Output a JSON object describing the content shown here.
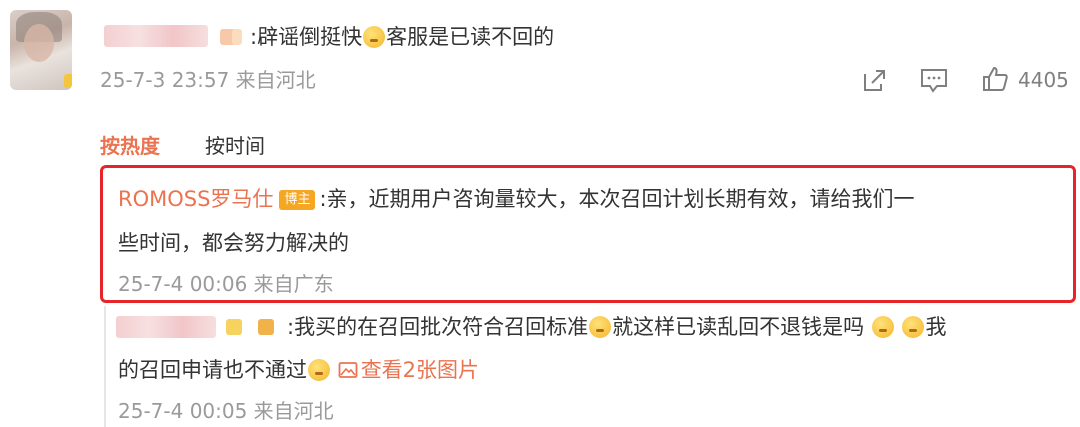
{
  "comment1": {
    "text_part1": ":辟谣倒挺快",
    "text_part2": "客服是已读不回的",
    "meta": "25-7-3 23:57 来自河北",
    "like_count": "4405",
    "icons": [
      "share-icon",
      "comment-icon",
      "like-icon"
    ]
  },
  "sort_tabs": {
    "hot": "按热度",
    "time": "按时间"
  },
  "reply1": {
    "author": "ROMOSS罗马仕",
    "badge": "博主",
    "line1": ":亲，近期用户咨询量较大，本次召回计划长期有效，请给我们一",
    "line2": "些时间，都会努力解决的",
    "meta": "25-7-4 00:06 来自广东"
  },
  "reply2": {
    "line1_part1": ":我买的在召回批次符合召回标准",
    "line1_part2": "就这样已读乱回不退钱是吗",
    "line1_part3": "我",
    "line2_part1": "的召回申请也不通过",
    "view_images": "查看2张图片",
    "meta": "25-7-4 00:05 来自河北"
  },
  "colors": {
    "accent": "#eb7350",
    "highlight_border": "#e8242b",
    "badge": "#f5a623",
    "meta": "#9a9a9a"
  }
}
